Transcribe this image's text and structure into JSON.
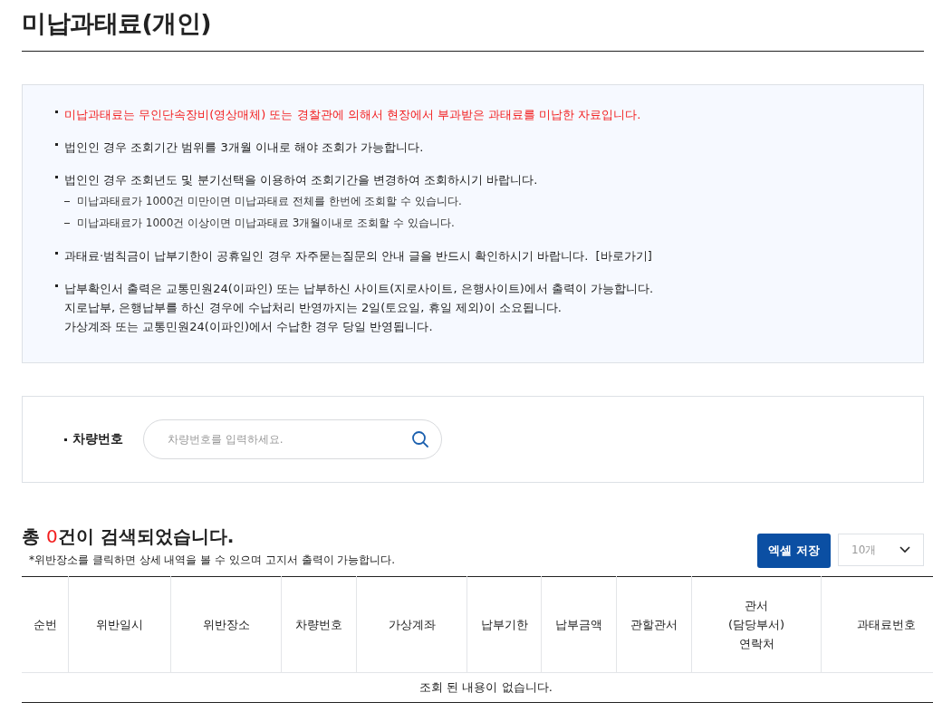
{
  "page_title": "미납과태료(개인)",
  "notices": [
    {
      "kind": "bullet",
      "highlight": true,
      "lines": [
        "미납과태료는 무인단속장비(영상매체) 또는 경찰관에 의해서 현장에서 부과받은 과태료를 미납한 자료입니다."
      ]
    },
    {
      "kind": "bullet",
      "highlight": false,
      "lines": [
        "법인인 경우 조회기간 범위를 3개월 이내로 해야 조회가 가능합니다."
      ]
    },
    {
      "kind": "bullet",
      "highlight": false,
      "lines": [
        "법인인 경우 조회년도 및 분기선택을 이용하여 조회기간을 변경하여 조회하시기 바랍니다."
      ]
    },
    {
      "kind": "sub",
      "highlight": false,
      "lines": [
        "미납과태료가 1000건 미만이면 미납과태료 전체를 한번에 조회할 수 있습니다."
      ]
    },
    {
      "kind": "sub",
      "highlight": false,
      "lines": [
        "미납과태료가 1000건 이상이면 미납과태료 3개월이내로 조회할 수 있습니다."
      ]
    },
    {
      "kind": "bullet",
      "highlight": false,
      "lines": [
        "과태료·범칙금이 납부기한이 공휴일인 경우 자주묻는질문의 안내 글을 반드시 확인하시기 바랍니다."
      ],
      "link": "[바로가기]"
    },
    {
      "kind": "bullet",
      "highlight": false,
      "lines": [
        "납부확인서 출력은 교통민원24(이파인) 또는 납부하신 사이트(지로사이트, 은행사이트)에서 출력이 가능합니다.",
        "지로납부, 은행납부를 하신 경우에 수납처리 반영까지는 2일(토요일, 휴일 제외)이 소요됩니다.",
        "가상계좌 또는 교통민원24(이파인)에서 수납한 경우 당일 반영됩니다."
      ]
    }
  ],
  "search": {
    "label": "차량번호",
    "placeholder": "차량번호를 입력하세요."
  },
  "result": {
    "prefix": "총 ",
    "count": "0",
    "suffix": "건이 검색되었습니다.",
    "note": "*위반장소를 클릭하면 상세 내역을 볼 수 있으며 고지서 출력이 가능합니다."
  },
  "excel_button": "엑셀 저장",
  "page_size": "10개",
  "table": {
    "columns": [
      {
        "lines": [
          "순번"
        ]
      },
      {
        "lines": [
          "위반일시"
        ]
      },
      {
        "lines": [
          "위반장소"
        ]
      },
      {
        "lines": [
          "차량번호"
        ]
      },
      {
        "lines": [
          "가상계좌"
        ]
      },
      {
        "lines": [
          "납부기한"
        ]
      },
      {
        "lines": [
          "납부금액"
        ]
      },
      {
        "lines": [
          "관할관서"
        ]
      },
      {
        "lines": [
          "관서",
          "(담당부서)",
          "연락처"
        ]
      },
      {
        "lines": [
          "과태료번호"
        ]
      }
    ],
    "empty_message": "조회 된 내용이 없습니다."
  }
}
